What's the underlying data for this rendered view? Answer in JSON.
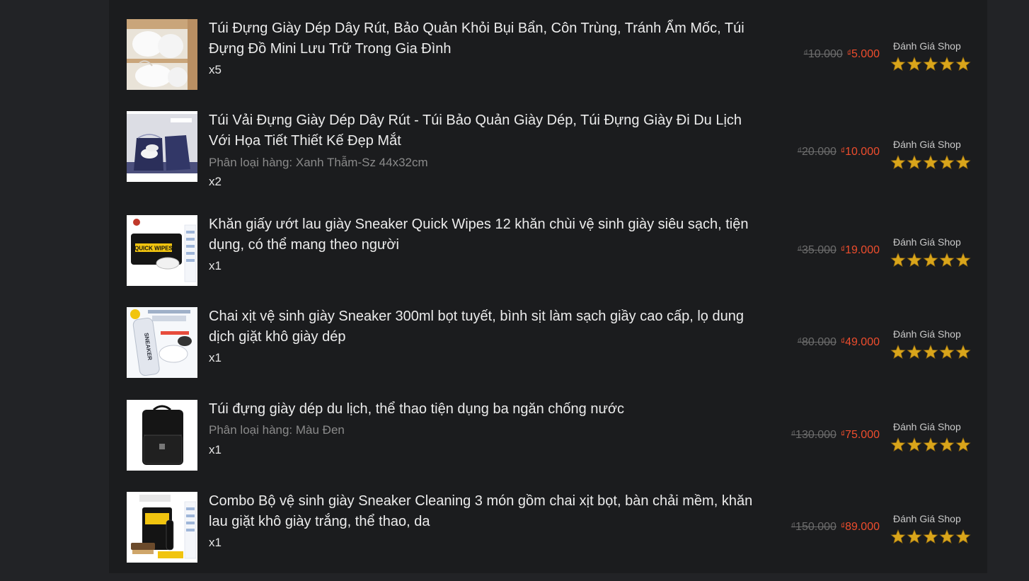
{
  "colors": {
    "background": "#222326",
    "panel": "#1b1c1e",
    "text": "#ececec",
    "muted": "#8a8a8a",
    "old_price": "#6d6d6d",
    "new_price": "#ee4d2d",
    "star": "#d9a51b"
  },
  "items": [
    {
      "name": "Túi Đựng Giày Dép Dây Rút, Bảo Quản Khỏi Bụi Bẩn, Côn Trùng, Tránh Ẩm Mốc, Túi Đựng Đồ Mini Lưu Trữ Trong Gia Đình",
      "variation": "",
      "quantity": "x5",
      "old_price": "10.000",
      "new_price": "5.000",
      "currency": "₫",
      "rating_label": "Đánh Giá Shop",
      "stars": 5
    },
    {
      "name": "Túi Vải Đựng Giày Dép Dây Rút - Túi Bảo Quản Giày Dép, Túi Đựng Giày Đi Du Lịch Với Họa Tiết Thiết Kế Đẹp Mắt",
      "variation": "Phân loại hàng: Xanh Thẫm-Sz 44x32cm",
      "quantity": "x2",
      "old_price": "20.000",
      "new_price": "10.000",
      "currency": "₫",
      "rating_label": "Đánh Giá Shop",
      "stars": 5
    },
    {
      "name": "Khăn giấy ướt lau giày Sneaker Quick Wipes 12 khăn chùi vệ sinh giày siêu sạch, tiện dụng, có thể mang theo người",
      "variation": "",
      "quantity": "x1",
      "old_price": "35.000",
      "new_price": "19.000",
      "currency": "₫",
      "rating_label": "Đánh Giá Shop",
      "stars": 5
    },
    {
      "name": "Chai xịt vệ sinh giày Sneaker 300ml bọt tuyết, bình sịt làm sạch giầy cao cấp, lọ dung dịch giặt khô giày dép",
      "variation": "",
      "quantity": "x1",
      "old_price": "80.000",
      "new_price": "49.000",
      "currency": "₫",
      "rating_label": "Đánh Giá Shop",
      "stars": 5
    },
    {
      "name": "Túi đựng giày dép du lịch, thể thao tiện dụng ba ngăn chống nước",
      "variation": "Phân loại hàng: Màu Đen",
      "quantity": "x1",
      "old_price": "130.000",
      "new_price": "75.000",
      "currency": "₫",
      "rating_label": "Đánh Giá Shop",
      "stars": 5
    },
    {
      "name": "Combo Bộ vệ sinh giày Sneaker Cleaning 3 món gồm chai xịt bọt, bàn chải mềm, khăn lau giặt khô giày trắng, thể thao, da",
      "variation": "",
      "quantity": "x1",
      "old_price": "150.000",
      "new_price": "89.000",
      "currency": "₫",
      "rating_label": "Đánh Giá Shop",
      "stars": 5
    }
  ],
  "thumbnail_text": {
    "wipes_label": "QUICK WIPES",
    "spray_label": "SNEAKER"
  }
}
